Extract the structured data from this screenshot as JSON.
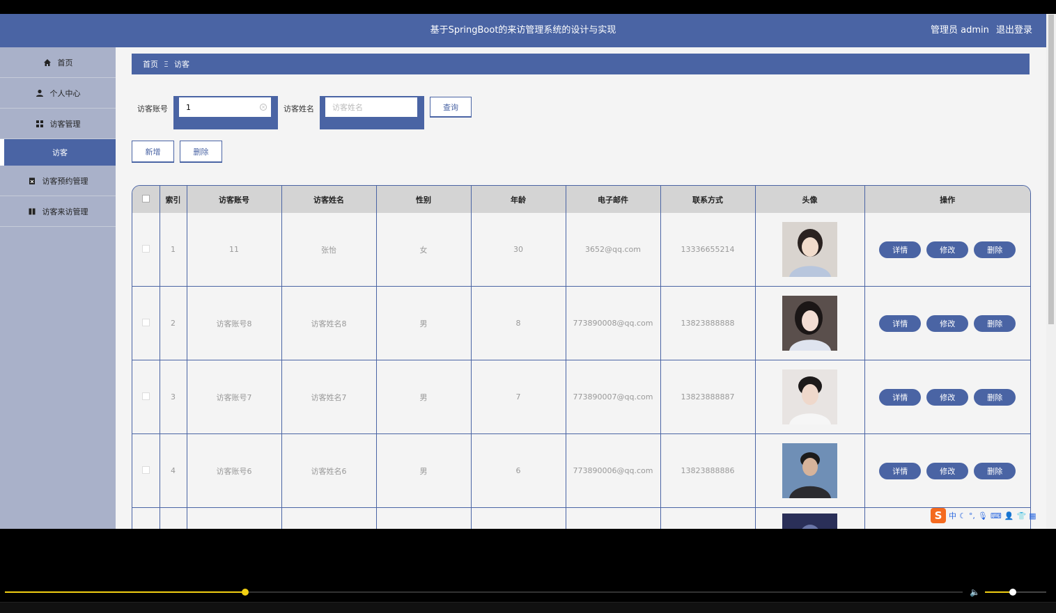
{
  "header": {
    "title": "基于SpringBoot的来访管理系统的设计与实现",
    "user_role": "管理员 admin",
    "logout": "退出登录"
  },
  "sidebar": {
    "items": [
      {
        "label": "首页",
        "icon": "home-icon"
      },
      {
        "label": "个人中心",
        "icon": "user-icon"
      },
      {
        "label": "访客管理",
        "icon": "grid-icon"
      },
      {
        "label": "访客",
        "icon": ""
      },
      {
        "label": "访客预约管理",
        "icon": "calendar-icon"
      },
      {
        "label": "访客来访管理",
        "icon": "book-icon"
      }
    ]
  },
  "breadcrumb": {
    "home": "首页",
    "separator": "Ξ",
    "current": "访客"
  },
  "search": {
    "account_label": "访客账号",
    "account_value": "1",
    "account_placeholder": "访客账号",
    "name_label": "访客姓名",
    "name_placeholder": "访客姓名",
    "query_button": "查询"
  },
  "actions": {
    "add": "新增",
    "delete": "删除"
  },
  "table": {
    "headers": [
      "",
      "索引",
      "访客账号",
      "访客姓名",
      "性别",
      "年龄",
      "电子邮件",
      "联系方式",
      "头像",
      "操作"
    ],
    "rows": [
      {
        "index": "1",
        "account": "11",
        "name": "张怡",
        "gender": "女",
        "age": "30",
        "email": "3652@qq.com",
        "phone": "13336655214"
      },
      {
        "index": "2",
        "account": "访客账号8",
        "name": "访客姓名8",
        "gender": "男",
        "age": "8",
        "email": "773890008@qq.com",
        "phone": "13823888888"
      },
      {
        "index": "3",
        "account": "访客账号7",
        "name": "访客姓名7",
        "gender": "男",
        "age": "7",
        "email": "773890007@qq.com",
        "phone": "13823888887"
      },
      {
        "index": "4",
        "account": "访客账号6",
        "name": "访客姓名6",
        "gender": "男",
        "age": "6",
        "email": "773890006@qq.com",
        "phone": "13823888886"
      }
    ],
    "row_buttons": {
      "detail": "详情",
      "edit": "修改",
      "delete": "删除"
    }
  },
  "ime": {
    "logo": "S",
    "mode": "中"
  },
  "player": {
    "progress": 0.251,
    "volume": 0.45
  },
  "colors": {
    "primary": "#4a64a4",
    "sidebar": "#a9b1c9",
    "accent": "#f2d012"
  }
}
